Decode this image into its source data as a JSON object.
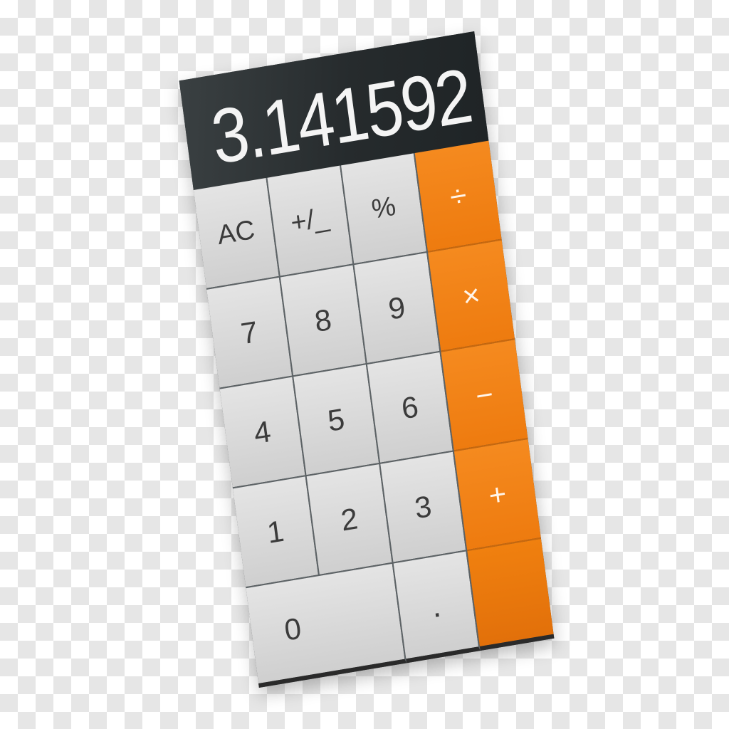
{
  "display": {
    "value": "3.141592"
  },
  "keys": {
    "ac": "AC",
    "plus_minus": "+/_",
    "percent": "%",
    "divide": "÷",
    "seven": "7",
    "eight": "8",
    "nine": "9",
    "multiply": "×",
    "four": "4",
    "five": "5",
    "six": "6",
    "minus": "−",
    "one": "1",
    "two": "2",
    "three": "3",
    "plus": "+",
    "zero": "0",
    "decimal": ".",
    "equals": ""
  },
  "colors": {
    "display_background": "#262b2d",
    "key_background": "#d9d9d9",
    "operator_background": "#f08316",
    "key_text": "#3b3b3b",
    "display_text": "#f4f4f4"
  }
}
